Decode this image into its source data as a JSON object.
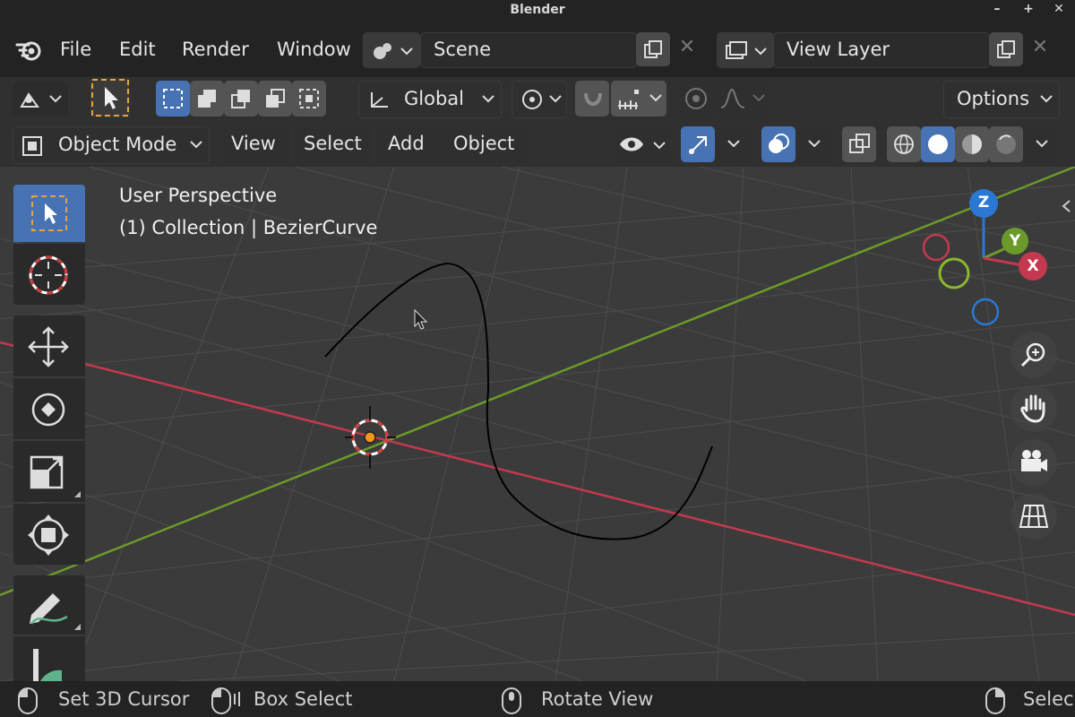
{
  "window": {
    "title": "Blender",
    "minimize": "–",
    "maximize": "+",
    "close": "✕"
  },
  "menu": {
    "file": "File",
    "edit": "Edit",
    "render": "Render",
    "window": "Window"
  },
  "scene": {
    "name": "Scene",
    "view_layer": "View Layer"
  },
  "header": {
    "transform_orientation": "Global",
    "options_label": "Options",
    "mode": "Object Mode",
    "view": "View",
    "select": "Select",
    "add": "Add",
    "object": "Object"
  },
  "viewport": {
    "perspective_label": "User Perspective",
    "collection_label": "(1) Collection | BezierCurve",
    "gizmo": {
      "z": "Z",
      "y": "Y",
      "x": "X"
    }
  },
  "status": {
    "left_action": "Set 3D Cursor",
    "middle_action": "Box Select",
    "rotate_action": "Rotate View",
    "right_action": "Selec"
  },
  "colors": {
    "accent": "#4772b3",
    "x_axis": "#c4394f",
    "y_axis": "#6c9a2a",
    "z_axis": "#2a78d4",
    "viewport_bg": "#3b3b3b"
  }
}
